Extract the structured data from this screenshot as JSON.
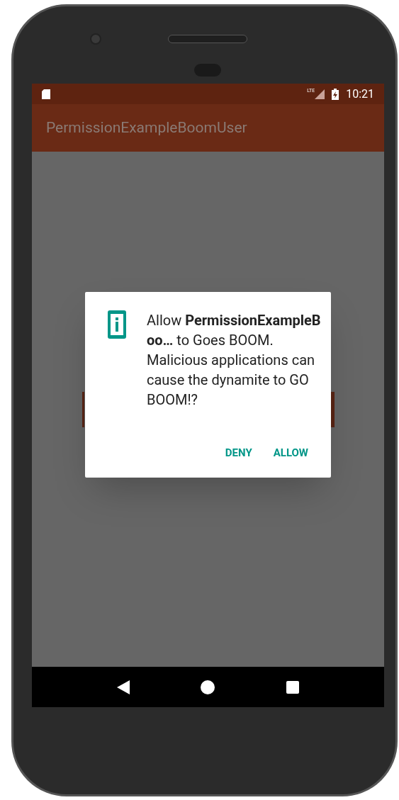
{
  "status_bar": {
    "network": "LTE",
    "time": "10:21"
  },
  "app_bar": {
    "title": "PermissionExampleBoomUser"
  },
  "dialog": {
    "message": "Allow **PermissionExampleBoo…** to Goes BOOM. Malicious applications can cause the dynamite to GO BOOM!?",
    "buttons": [
      "DENY",
      "ALLOW"
    ]
  }
}
